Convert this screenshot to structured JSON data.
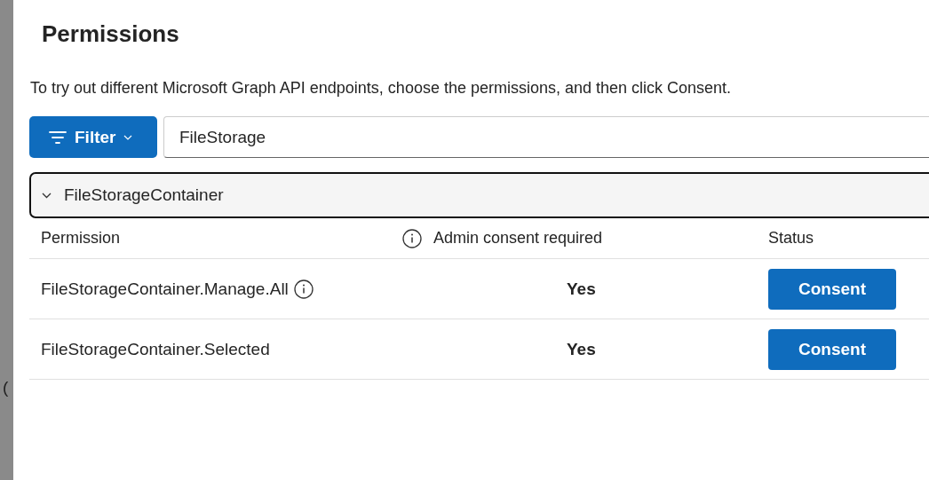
{
  "background": {
    "fragments": [
      "("
    ]
  },
  "dialog": {
    "title": "Permissions",
    "description": "To try out different Microsoft Graph API endpoints, choose the permissions, and then click Consent.",
    "filter_button": {
      "label": "Filter"
    },
    "search": {
      "value": "FileStorage"
    },
    "group": {
      "label": "FileStorageContainer",
      "expanded": true
    },
    "columns": [
      {
        "label": "Permission",
        "info": false
      },
      {
        "label": "Admin consent required",
        "info": true
      },
      {
        "label": "Status",
        "info": false
      }
    ],
    "rows": [
      {
        "permission": "FileStorageContainer.Manage.All",
        "info": true,
        "admin_consent": "Yes",
        "action": "Consent"
      },
      {
        "permission": "FileStorageContainer.Selected",
        "info": false,
        "admin_consent": "Yes",
        "action": "Consent"
      }
    ]
  }
}
